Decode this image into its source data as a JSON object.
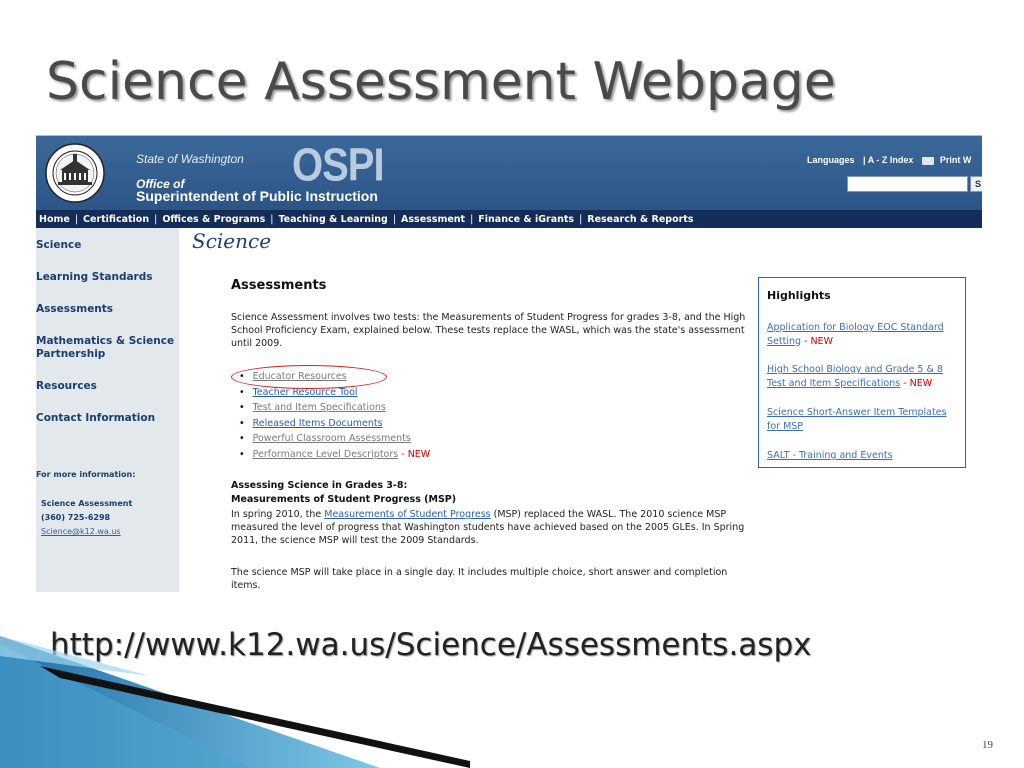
{
  "slide": {
    "title": "Science Assessment Webpage",
    "url": "http://www.k12.wa.us/Science/Assessments.aspx",
    "page_number": "19"
  },
  "header": {
    "state": "State of Washington",
    "office_of": "Office of",
    "agency": "Superintendent of Public Instruction",
    "logo": "OSPI",
    "util_languages": "Languages",
    "util_az": "| A - Z Index",
    "util_print": "Print W",
    "search_go": "S"
  },
  "topnav": [
    {
      "label": "Home"
    },
    {
      "label": "Certification"
    },
    {
      "label": "Offices & Programs"
    },
    {
      "label": "Teaching & Learning"
    },
    {
      "label": "Assessment"
    },
    {
      "label": "Finance & iGrants"
    },
    {
      "label": "Research & Reports"
    }
  ],
  "leftnav": {
    "items": [
      {
        "label": "Science"
      },
      {
        "label": "Learning Standards"
      },
      {
        "label": "Assessments"
      },
      {
        "label": "Mathematics & Science Partnership"
      },
      {
        "label": "Resources"
      },
      {
        "label": "Contact Information"
      }
    ],
    "more_info": "For more information:",
    "contact_name": "Science Assessment",
    "contact_phone": "(360) 725-6298",
    "contact_email": "Science@k12.wa.us"
  },
  "main": {
    "section_script": "Science",
    "heading": "Assessments",
    "intro": "Science Assessment involves two tests: the Measurements of Student Progress for grades 3-8, and the High School Proficiency Exam, explained below. These tests replace the WASL, which was the state's assessment until 2009.",
    "resources": [
      {
        "label": "Educator Resources",
        "new": ""
      },
      {
        "label": "Teacher Resource Tool",
        "new": ""
      },
      {
        "label": "Test and Item Specifications",
        "new": ""
      },
      {
        "label": "Released Items Documents",
        "new": ""
      },
      {
        "label": "Powerful Classroom Assessments",
        "new": ""
      },
      {
        "label": "Performance Level Descriptors",
        "new": " - NEW"
      }
    ],
    "sub_heading1": "Assessing Science in Grades 3-8:",
    "sub_heading2": "Measurements of Student Progress (MSP)",
    "msp_pre": "In spring 2010, the ",
    "msp_link": "Measurements of Student Progress",
    "msp_post": " (MSP) replaced the WASL. The 2010 science MSP measured the level of progress that Washington students have achieved based on the 2005 GLEs. In Spring 2011, the science MSP will test the 2009 Standards.",
    "msp_para2": "The science MSP will take place in a single day. It includes multiple choice, short answer and completion items."
  },
  "highlights": {
    "title": "Highlights",
    "items": [
      {
        "label": "Application for Biology EOC Standard Setting",
        "new": " - NEW"
      },
      {
        "label": "High School Biology and Grade 5 & 8 Test and Item Specifications",
        "new": " - NEW"
      },
      {
        "label": "Science Short-Answer Item Templates for MSP",
        "new": ""
      },
      {
        "label": "SALT - Training and Events",
        "new": ""
      }
    ]
  },
  "colors": {
    "header_blue": "#2f5a8c",
    "nav_navy": "#132c58",
    "link_blue": "#2a5db0",
    "new_red": "#cc0000",
    "highlight_border": "#3560a8"
  }
}
